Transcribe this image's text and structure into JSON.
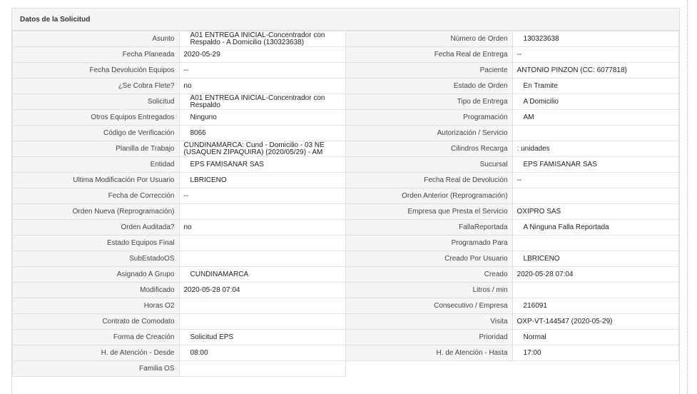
{
  "panel": {
    "title": "Datos de la Solicitud"
  },
  "rows": [
    {
      "l1": "Asunto",
      "v1": "A01 ENTREGA INICIAL-Concentrador con Respaldo - A Domicilio (130323638)",
      "l2": "Número de Orden",
      "v2": "130323638"
    },
    {
      "l1": "Fecha Planeada",
      "v1": "2020-05-29",
      "l2": "Fecha Real de Entrega",
      "v2": "--"
    },
    {
      "l1": "Fecha Devolución Equipos",
      "v1": "--",
      "l2": "Paciente",
      "v2": "ANTONIO PINZON (CC: 6077818)"
    },
    {
      "l1": "¿Se Cobra Flete?",
      "v1": "no",
      "l2": "Estado de Orden",
      "v2": "En Tramite"
    },
    {
      "l1": "Solicitud",
      "v1": "A01 ENTREGA INICIAL-Concentrador con Respaldo",
      "l2": "Tipo de Entrega",
      "v2": "A Domicilio"
    },
    {
      "l1": "Otros Equipos Entregados",
      "v1": "Ninguno",
      "l2": "Programación",
      "v2": "AM"
    },
    {
      "l1": "Código de Verificación",
      "v1": "8066",
      "l2": "Autorización / Servicio",
      "v2": ""
    },
    {
      "l1": "Planilla de Trabajo",
      "v1": "CUNDINAMARCA: Cund - Domicilio - 03 NE (USAQUEN ZIPAQUIRA) (2020/05/29) - AM",
      "l2": "Cilindros Recarga",
      "v2": ": unidades"
    },
    {
      "l1": "Entidad",
      "v1": "EPS FAMISANAR SAS",
      "l2": "Sucursal",
      "v2": "EPS FAMISANAR SAS"
    },
    {
      "l1": "Ultima Modificación Por Usuario",
      "v1": "LBRICENO",
      "l2": "Fecha Real de Devolución",
      "v2": "--"
    },
    {
      "l1": "Fecha de Corrección",
      "v1": "--",
      "l2": "Orden Anterior (Reprogramación)",
      "v2": ""
    },
    {
      "l1": "Orden Nueva (Reprogramación)",
      "v1": "",
      "l2": "Empresa que Presta el Servicio",
      "v2": "OXIPRO SAS"
    },
    {
      "l1": "Orden Auditada?",
      "v1": "no",
      "l2": "FallaReportada",
      "v2": "A Ninguna Falla Reportada"
    },
    {
      "l1": "Estado Equipos Final",
      "v1": "",
      "l2": "Programado Para",
      "v2": ""
    },
    {
      "l1": "SubEstadoOS",
      "v1": "",
      "l2": "Creado Por Usuario",
      "v2": "LBRICENO"
    },
    {
      "l1": "Asignado A Grupo",
      "v1": "CUNDINAMARCA",
      "l2": "Creado",
      "v2": "2020-05-28 07:04"
    },
    {
      "l1": "Modificado",
      "v1": "2020-05-28 07:04",
      "l2": "Litros / min",
      "v2": ""
    },
    {
      "l1": "Horas O2",
      "v1": "",
      "l2": "Consecutivo / Empresa",
      "v2": "216091"
    },
    {
      "l1": "Contrato de Comodato",
      "v1": "",
      "l2": "Visita",
      "v2": "OXP-VT-144547 (2020-05-29)"
    },
    {
      "l1": "Forma de Creación",
      "v1": "Solicitud EPS",
      "l2": "Prioridad",
      "v2": "Normal"
    },
    {
      "l1": "H. de Atención - Desde",
      "v1": "08:00",
      "l2": "H. de Atención - Hasta",
      "v2": "17:00"
    },
    {
      "l1": "Familia OS",
      "v1": ""
    }
  ]
}
